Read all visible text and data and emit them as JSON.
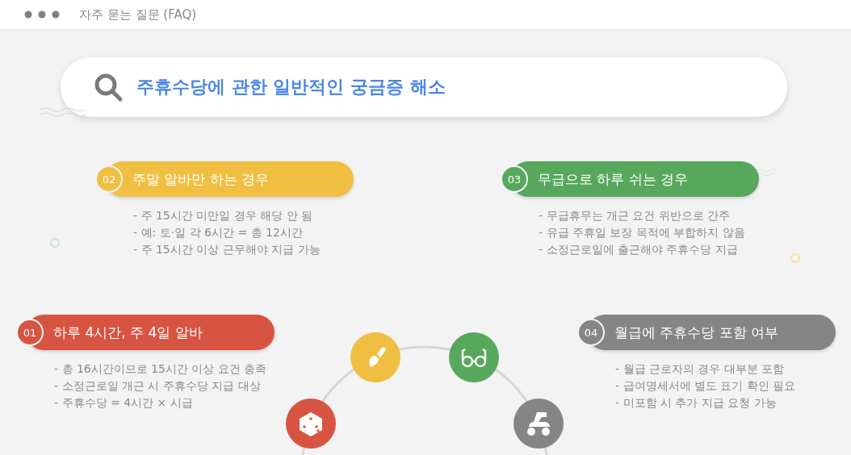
{
  "window": {
    "title": "자주 묻는 질문 (FAQ)"
  },
  "search": {
    "value": "주휴수당에 관한 일반적인 궁금증 해소"
  },
  "cards": [
    {
      "number": "02",
      "title": "주말 알바만 하는 경우",
      "color": "#f0bf42",
      "bullets": [
        "- 주 15시간 미만일 경우 해당 안 됨",
        "- 예: 토·일 각 6시간 = 총 12시간",
        "- 주 15시간 이상 근무해야 지급 가능"
      ]
    },
    {
      "number": "03",
      "title": "무급으로 하루 쉬는 경우",
      "color": "#57a85c",
      "bullets": [
        "- 무급휴무는 개근 요건 위반으로 간주",
        "- 유급 주휴일 보장 목적에 부합하지 않음",
        "- 소정근로일에 출근해야 주휴수당 지급"
      ]
    },
    {
      "number": "01",
      "title": "하루 4시간, 주 4일 알바",
      "color": "#d85442",
      "bullets": [
        "- 총 16시간이므로 15시간 이상 요건 충족",
        "- 소정근로일 개근 시 주휴수당 지급 대상",
        "- 주휴수당 = 4시간 × 시급"
      ]
    },
    {
      "number": "04",
      "title": "월급에 주휴수당 포함 여부",
      "color": "#858585",
      "bullets": [
        "- 월급 근로자의 경우 대부분 포함",
        "- 급여명세서에 별도 표기 확인 필요",
        "- 미포함 시 추가 지급 요청 가능"
      ]
    }
  ]
}
